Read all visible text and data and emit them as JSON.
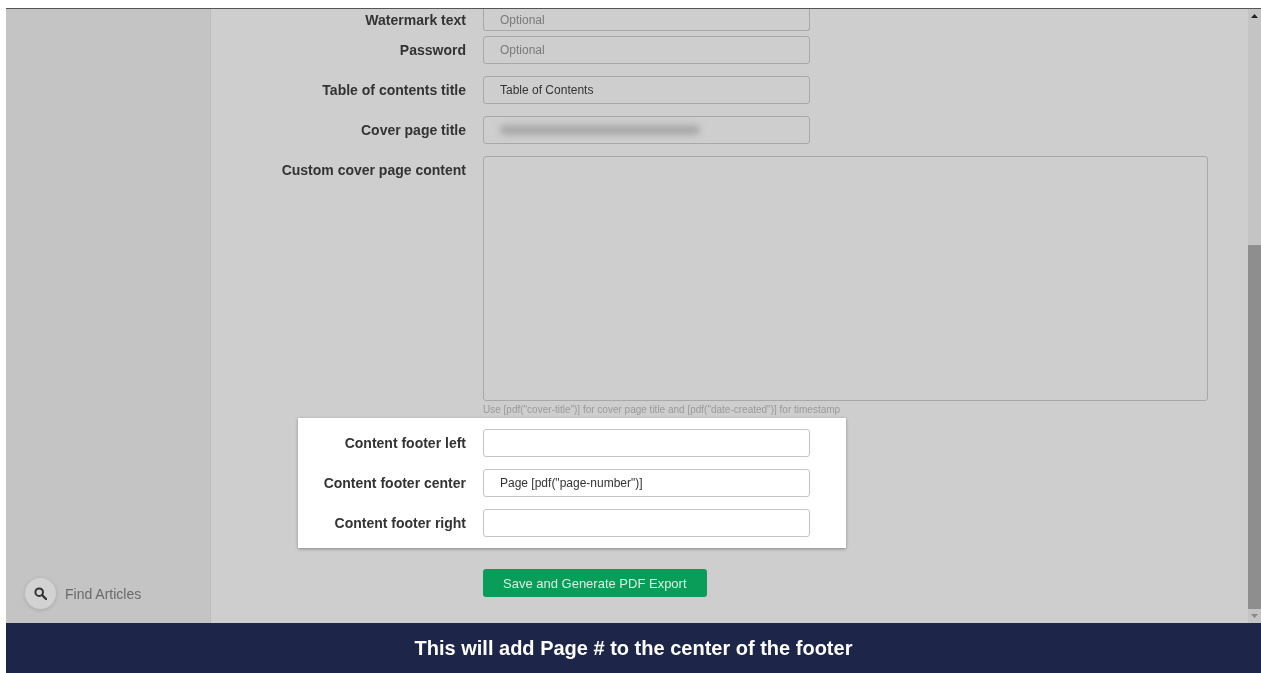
{
  "sidebar": {
    "search_label": "Find Articles"
  },
  "form": {
    "fields": [
      {
        "kind": "input",
        "label": "Watermark text",
        "placeholder": "Optional"
      },
      {
        "kind": "input",
        "label": "Password",
        "placeholder": "Optional"
      },
      {
        "kind": "input",
        "label": "Table of contents title",
        "value": "Table of Contents"
      },
      {
        "kind": "blurred",
        "label": "Cover page title"
      }
    ],
    "cover_content": {
      "label": "Custom cover page content",
      "hint": "Use [pdf(\"cover-title\")] for cover page title and [pdf(\"date-created\")] for timestamp"
    },
    "footer_fields": [
      {
        "label": "Content footer left"
      },
      {
        "label": "Content footer center",
        "value": "Page [pdf(\"page-number\")]"
      },
      {
        "label": "Content footer right"
      }
    ],
    "submit_button": "Save and Generate PDF Export"
  },
  "caption": "This will add Page # to the center of the footer"
}
